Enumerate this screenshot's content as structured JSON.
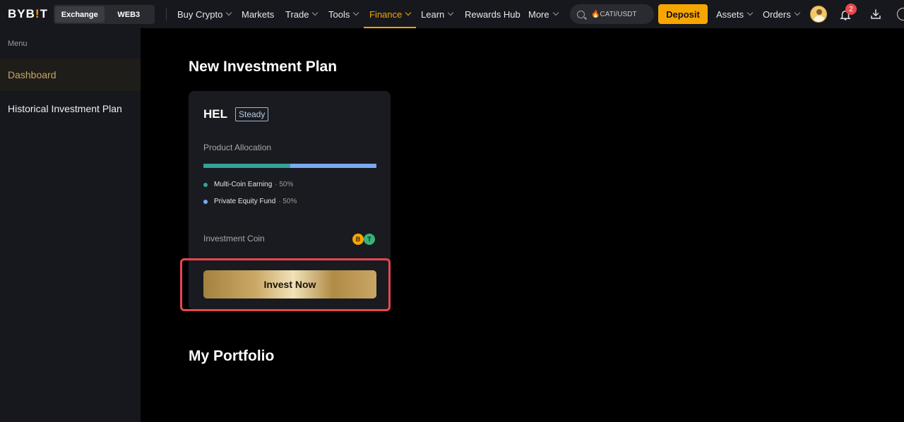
{
  "header": {
    "logo_text_a": "BYB",
    "logo_text_b": "!",
    "logo_text_c": "T",
    "mode_tabs": [
      {
        "label": "Exchange",
        "active": true
      },
      {
        "label": "WEB3",
        "active": false
      }
    ],
    "nav": [
      {
        "label": "Buy Crypto",
        "dropdown": true
      },
      {
        "label": "Markets",
        "dropdown": false
      },
      {
        "label": "Trade",
        "dropdown": true
      },
      {
        "label": "Tools",
        "dropdown": true
      },
      {
        "label": "Finance",
        "dropdown": true,
        "active": true
      },
      {
        "label": "Learn",
        "dropdown": true
      },
      {
        "label": "Rewards Hub",
        "dropdown": false
      },
      {
        "label": "More",
        "dropdown": true
      }
    ],
    "search_value": "🔥CATI/USDT",
    "deposit_label": "Deposit",
    "assets_label": "Assets",
    "orders_label": "Orders",
    "notification_count": "2",
    "accent_color": "#f7a600"
  },
  "sidebar": {
    "menu_label": "Menu",
    "items": [
      {
        "label": "Dashboard",
        "active": true
      },
      {
        "label": "Historical Investment Plan",
        "active": false
      }
    ]
  },
  "main": {
    "new_plan_title": "New Investment Plan",
    "portfolio_title": "My Portfolio",
    "plan": {
      "name": "HEL",
      "tag": "Steady",
      "allocation_label": "Product Allocation",
      "allocations": [
        {
          "name": "Multi-Coin Earning",
          "pct_text": "· 50%",
          "percent": 50,
          "color": "#35a29a"
        },
        {
          "name": "Private Equity Fund",
          "pct_text": "· 50%",
          "percent": 50,
          "color": "#7aa9f0"
        }
      ],
      "coin_label": "Investment Coin",
      "coins": [
        {
          "symbol": "B",
          "icon": "btc-coin-icon"
        },
        {
          "symbol": "T",
          "icon": "usdt-coin-icon"
        }
      ],
      "invest_label": "Invest Now"
    }
  }
}
